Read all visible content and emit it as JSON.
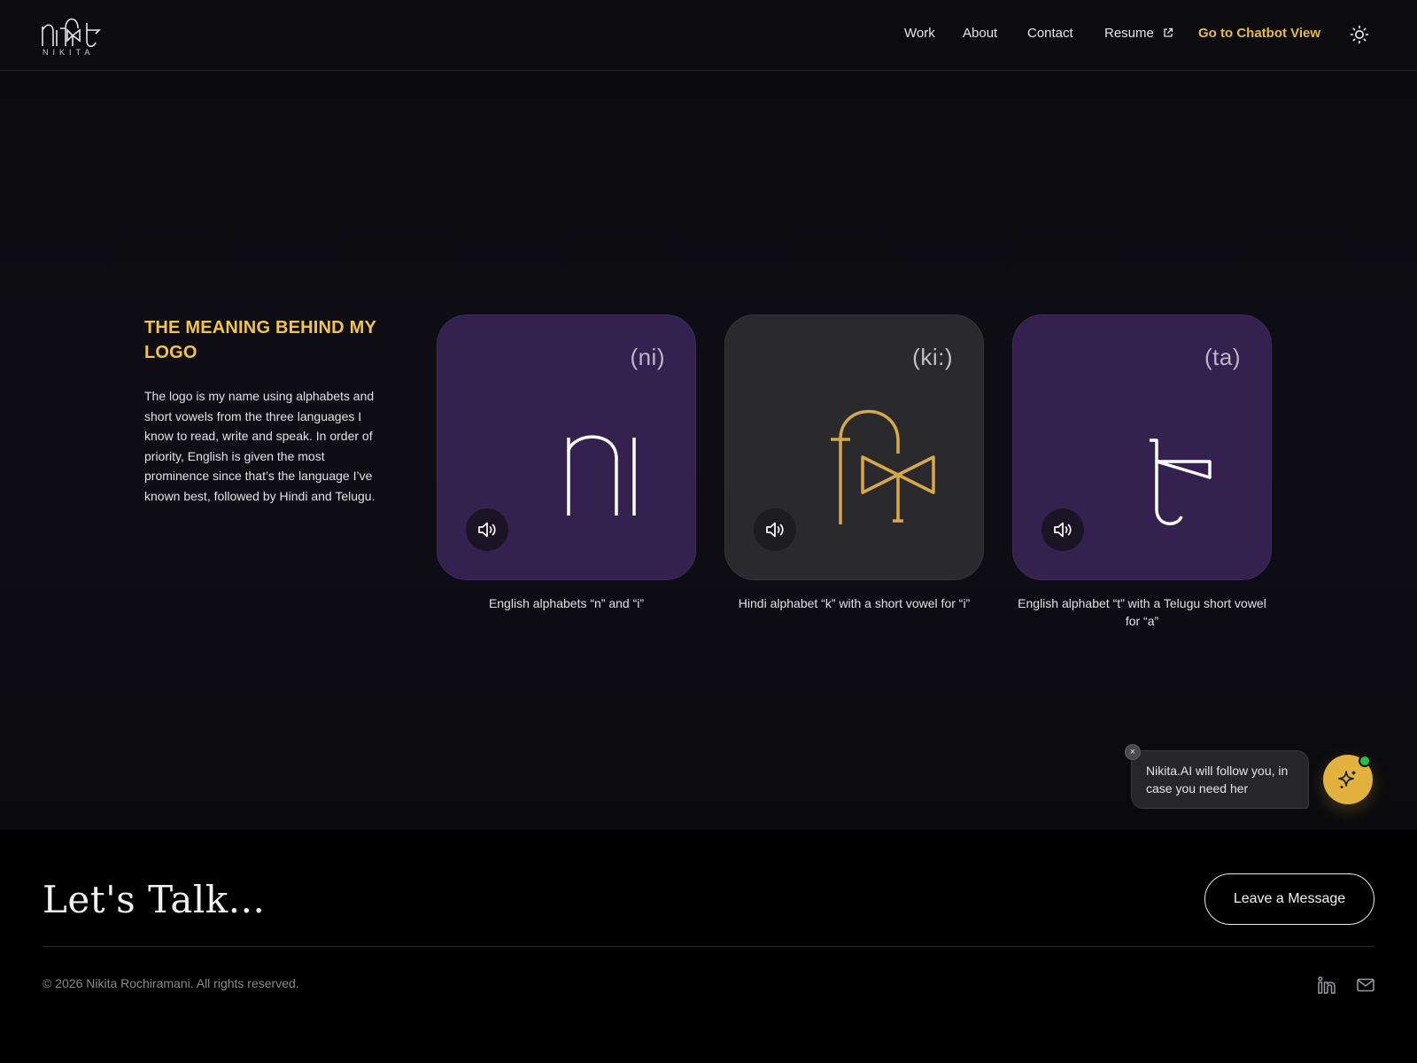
{
  "header": {
    "logo_word": "NIKITA",
    "nav": {
      "work": "Work",
      "about": "About",
      "contact": "Contact",
      "resume": "Resume",
      "chatbot": "Go to Chatbot View"
    },
    "icons": {
      "resume": "external-link-icon",
      "theme": "sun-icon"
    }
  },
  "intro": {
    "title": "THE MEANING BEHIND MY LOGO",
    "text": "The logo is my name using alphabets and short vowels from the three languages I know to read, write and speak. In order of priority, English is given the most prominence since that’s the language I’ve known best, followed by Hindi and Telugu."
  },
  "cards": [
    {
      "phonetic": "(ni)",
      "caption": "English alphabets “n” and “i”",
      "bg": "#352150"
    },
    {
      "phonetic": "(ki:)",
      "caption": "Hindi alphabet “k” with a short vowel for “i”",
      "bg": "#2a2a2c"
    },
    {
      "phonetic": "(ta)",
      "caption": "English alphabet “t” with a Telugu short vowel for “a”",
      "bg": "#352150"
    }
  ],
  "chat": {
    "message": "Nikita.AI will follow you, in case you need her",
    "close_label": "×",
    "accent": "#e2b23e",
    "status": "#1fbf56"
  },
  "footer": {
    "heading": "Let's Talk...",
    "button": "Leave a Message",
    "copyright": "© 2026 Nikita Rochiramani. All rights reserved.",
    "icons": [
      "linkedin-icon",
      "mail-icon"
    ]
  },
  "colors": {
    "accent_gold": "#f1c54d",
    "purple_card": "#352150",
    "background": "#050505"
  }
}
